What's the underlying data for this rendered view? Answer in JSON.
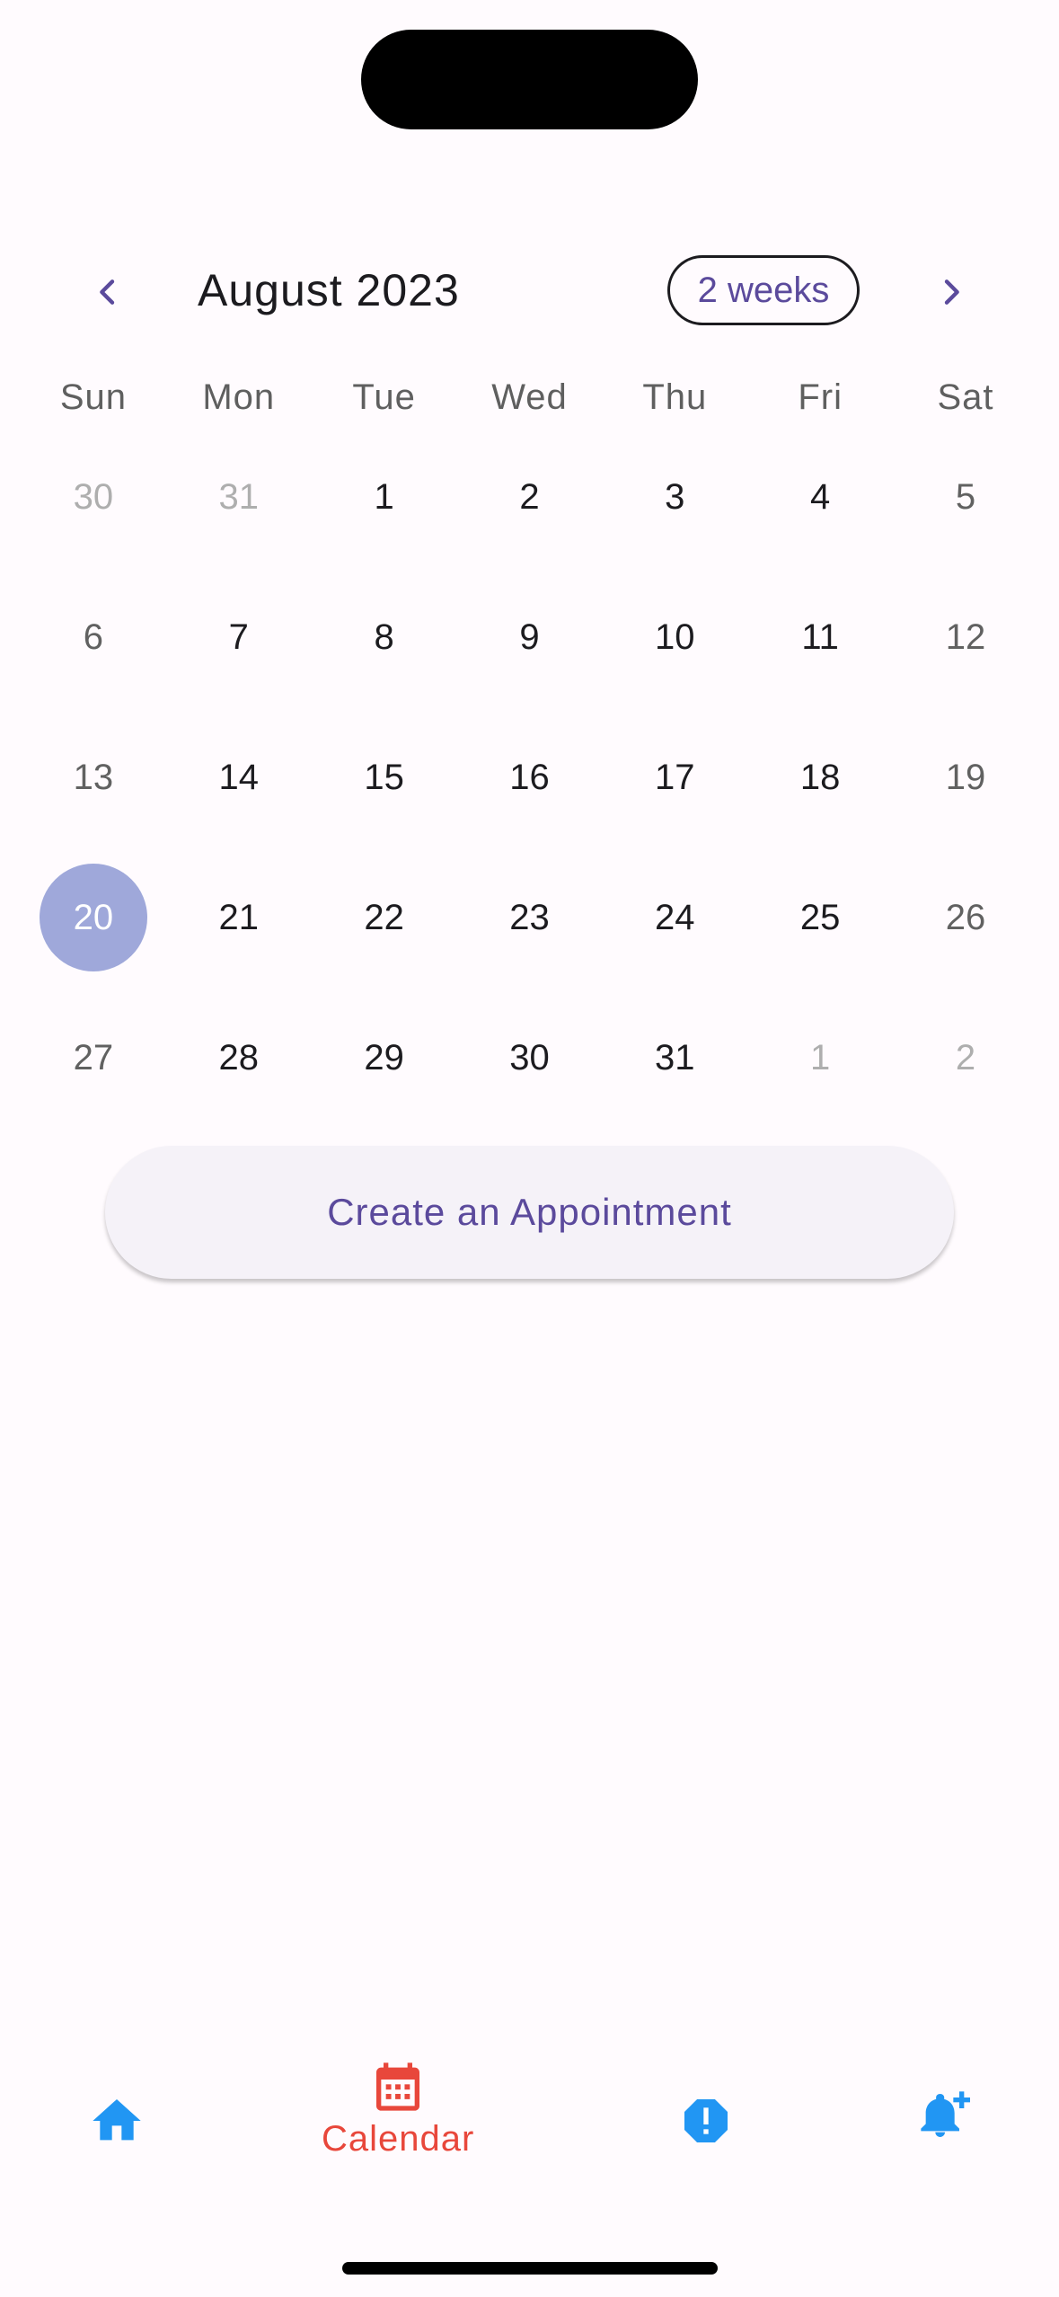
{
  "header": {
    "month_title": "August 2023",
    "format_button": "2 weeks",
    "prev_icon": "chevron-left-icon",
    "next_icon": "chevron-right-icon"
  },
  "weekdays": [
    "Sun",
    "Mon",
    "Tue",
    "Wed",
    "Thu",
    "Fri",
    "Sat"
  ],
  "weeks": [
    [
      "30",
      "31",
      "1",
      "2",
      "3",
      "4",
      "5"
    ],
    [
      "6",
      "7",
      "8",
      "9",
      "10",
      "11",
      "12"
    ],
    [
      "13",
      "14",
      "15",
      "16",
      "17",
      "18",
      "19"
    ],
    [
      "20",
      "21",
      "22",
      "23",
      "24",
      "25",
      "26"
    ],
    [
      "27",
      "28",
      "29",
      "30",
      "31",
      "1",
      "2"
    ]
  ],
  "selected_day": "20",
  "create_button": "Create an Appointment",
  "bottom_nav": {
    "items": [
      {
        "icon": "home-icon",
        "label": ""
      },
      {
        "icon": "calendar-icon",
        "label": "Calendar"
      },
      {
        "icon": "alert-octagon-icon",
        "label": ""
      },
      {
        "icon": "bell-plus-icon",
        "label": ""
      }
    ],
    "active_color": "#e8473b",
    "inactive_color": "#2196f3"
  },
  "colors": {
    "accent": "#5b4a9c",
    "selected_day": "#9fa8da",
    "background": "#fffbfe"
  }
}
